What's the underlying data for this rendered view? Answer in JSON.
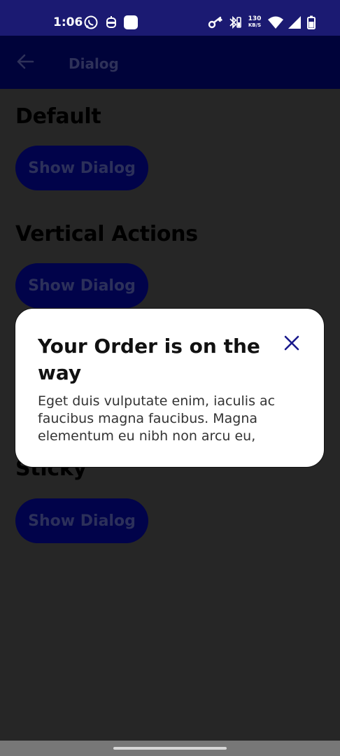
{
  "status_bar": {
    "time": "1:06",
    "network_speed_value": "130",
    "network_speed_unit": "KB/S",
    "icons": [
      "whatsapp-icon",
      "robot-icon",
      "app-square-icon",
      "key-icon",
      "bluetooth-battery-icon",
      "wifi-icon",
      "signal-icon",
      "battery-icon"
    ]
  },
  "app_bar": {
    "title": "Dialog",
    "back_icon": "arrow-left-icon"
  },
  "sections": [
    {
      "heading": "Default",
      "button_label": "Show Dialog"
    },
    {
      "heading": "Vertical Actions",
      "button_label": "Show Dialog"
    },
    {
      "heading": "Sticky",
      "button_label": "Show Dialog"
    }
  ],
  "dialog": {
    "title": "Your Order is on the way",
    "body": "Eget duis vulputate enim, iaculis ac faucibus magna faucibus. Magna elementum eu nibh non arcu eu,",
    "close_icon": "close-icon"
  },
  "colors": {
    "status_bar_bg": "#1b1a72",
    "app_bar_bg": "#00033a",
    "scrim_bg": "#262626",
    "button_bg": "#01034a",
    "accent": "#1a1a8c"
  }
}
